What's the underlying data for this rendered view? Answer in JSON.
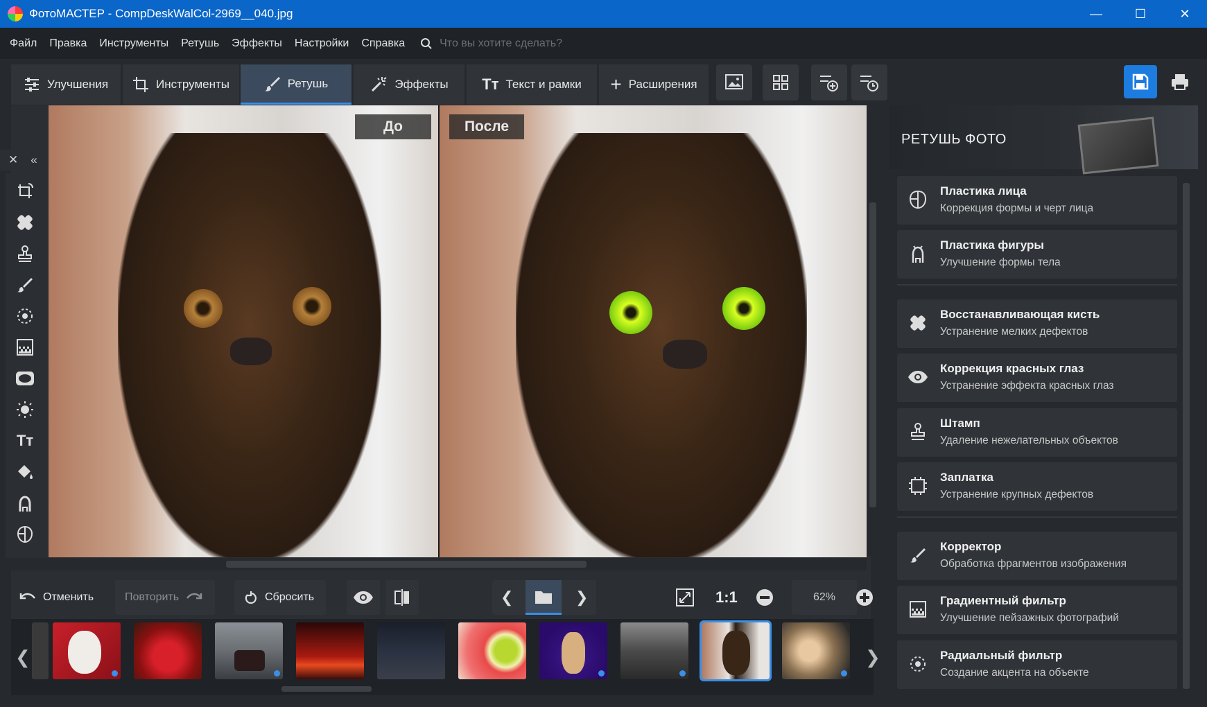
{
  "window": {
    "title": "ФотоМАСТЕР - CompDeskWalCol-2969__040.jpg"
  },
  "menu": {
    "items": [
      "Файл",
      "Правка",
      "Инструменты",
      "Ретушь",
      "Эффекты",
      "Настройки",
      "Справка"
    ],
    "search_placeholder": "Что вы хотите сделать?"
  },
  "tabs": [
    {
      "label": "Улучшения",
      "icon": "sliders-icon"
    },
    {
      "label": "Инструменты",
      "icon": "crop-icon"
    },
    {
      "label": "Ретушь",
      "icon": "brush-icon",
      "active": true
    },
    {
      "label": "Эффекты",
      "icon": "magic-wand-icon"
    },
    {
      "label": "Текст и рамки",
      "icon": "text-icon"
    },
    {
      "label": "Расширения",
      "icon": "plus-icon"
    }
  ],
  "compare": {
    "before_label": "До",
    "after_label": "После"
  },
  "bottom": {
    "undo": "Отменить",
    "redo": "Повторить",
    "reset": "Сбросить",
    "zoom_1to1": "1:1",
    "zoom_value": "62%"
  },
  "panel": {
    "title": "РЕТУШЬ ФОТО",
    "items": [
      {
        "title": "Пластика лица",
        "subtitle": "Коррекция формы и черт лица",
        "icon": "face-icon"
      },
      {
        "title": "Пластика фигуры",
        "subtitle": "Улучшение формы тела",
        "icon": "body-icon"
      },
      {
        "title": "Восстанавливающая кисть",
        "subtitle": "Устранение мелких дефектов",
        "icon": "healing-brush-icon"
      },
      {
        "title": "Коррекция красных глаз",
        "subtitle": "Устранение эффекта красных глаз",
        "icon": "eye-icon"
      },
      {
        "title": "Штамп",
        "subtitle": "Удаление нежелательных объектов",
        "icon": "stamp-icon"
      },
      {
        "title": "Заплатка",
        "subtitle": "Устранение крупных дефектов",
        "icon": "patch-icon"
      },
      {
        "title": "Корректор",
        "subtitle": "Обработка фрагментов изображения",
        "icon": "corrector-brush-icon"
      },
      {
        "title": "Градиентный фильтр",
        "subtitle": "Улучшение пейзажных фотографий",
        "icon": "gradient-filter-icon"
      },
      {
        "title": "Радиальный фильтр",
        "subtitle": "Создание акцента на объекте",
        "icon": "radial-filter-icon"
      }
    ]
  },
  "colors": {
    "accent": "#3a8fe8",
    "titlebar": "#0a66c8",
    "save": "#1c7ce0"
  }
}
